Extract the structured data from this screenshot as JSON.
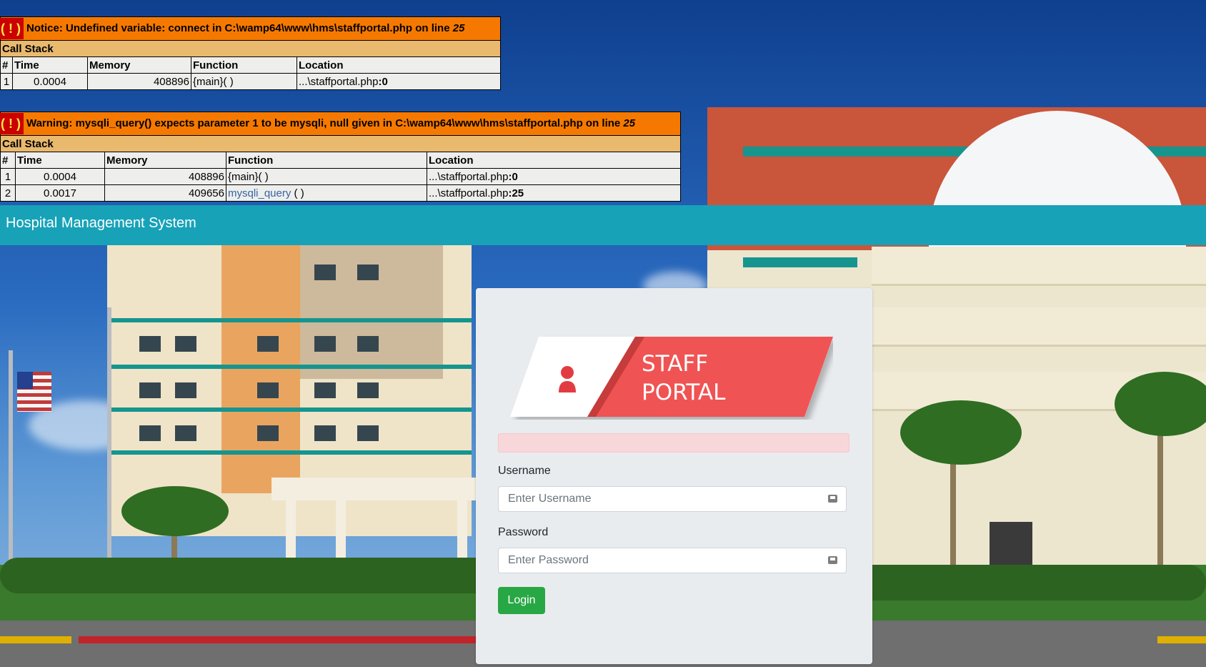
{
  "errors": [
    {
      "icon": "( ! )",
      "message": "Notice: Undefined variable: connect in C:\\wamp64\\www\\hms\\staffportal.php on line ",
      "line": "25",
      "call_stack_label": "Call Stack",
      "headers": [
        "#",
        "Time",
        "Memory",
        "Function",
        "Location"
      ],
      "rows": [
        {
          "num": "1",
          "time": "0.0004",
          "memory": "408896",
          "function": "{main}( )",
          "location": "...\\staffportal.php",
          "loc_line": ":0"
        }
      ]
    },
    {
      "icon": "( ! )",
      "message": "Warning: mysqli_query() expects parameter 1 to be mysqli, null given in C:\\wamp64\\www\\hms\\staffportal.php on line ",
      "line": "25",
      "call_stack_label": "Call Stack",
      "headers": [
        "#",
        "Time",
        "Memory",
        "Function",
        "Location"
      ],
      "rows": [
        {
          "num": "1",
          "time": "0.0004",
          "memory": "408896",
          "function": "{main}( )",
          "location": "...\\staffportal.php",
          "loc_line": ":0"
        },
        {
          "num": "2",
          "time": "0.0017",
          "memory": "409656",
          "function_link": "mysqli_query",
          "function_suffix": " ( )",
          "location": "...\\staffportal.php",
          "loc_line": ":25"
        }
      ]
    }
  ],
  "navbar": {
    "brand": "Hospital Management System",
    "color": "#17a2b8"
  },
  "login": {
    "logo_line1": "STAFF",
    "logo_line2": "PORTAL",
    "logo_color": "#f05252",
    "username_label": "Username",
    "username_placeholder": "Enter Username",
    "password_label": "Password",
    "password_placeholder": "Enter Password",
    "login_button": "Login",
    "button_color": "#28a745",
    "alert_color": "#f8d7da"
  }
}
